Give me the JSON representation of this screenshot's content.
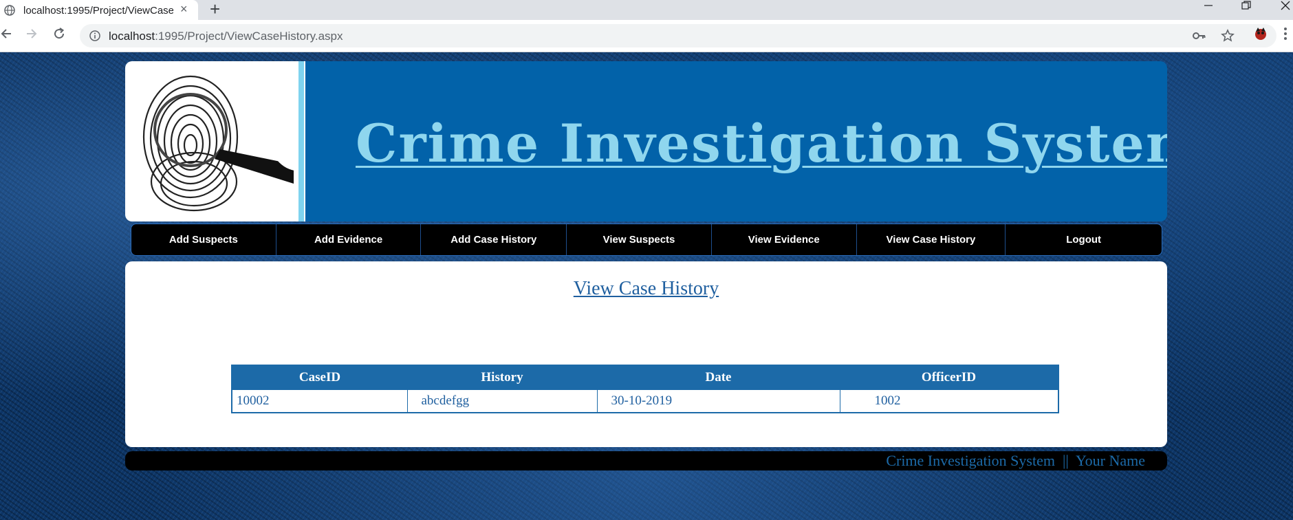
{
  "browser": {
    "tab_title": "localhost:1995/Project/ViewCase",
    "url_host": "localhost",
    "url_path": ":1995/Project/ViewCaseHistory.aspx",
    "new_tab": "+",
    "tab_close": "×"
  },
  "banner": {
    "title": "Crime Investigation System",
    "image": "fingerprint-magnifier"
  },
  "menu": {
    "items": [
      {
        "label": "Add Suspects"
      },
      {
        "label": "Add Evidence"
      },
      {
        "label": "Add Case History"
      },
      {
        "label": "View Suspects"
      },
      {
        "label": "View Evidence"
      },
      {
        "label": "View Case History"
      },
      {
        "label": "Logout"
      }
    ]
  },
  "main": {
    "title": "View Case History",
    "table": {
      "headers": [
        "CaseID",
        "History",
        "Date",
        "OfficerID"
      ],
      "rows": [
        [
          "10002",
          "abcdefgg",
          "30-10-2019",
          "1002"
        ]
      ]
    }
  },
  "footer": {
    "text": "Crime Investigation System  ||  Your Name"
  },
  "colors": {
    "banner_blue": "#0262a9",
    "title_cyan": "#8fd6ee",
    "grid_blue": "#1c6aa8"
  }
}
